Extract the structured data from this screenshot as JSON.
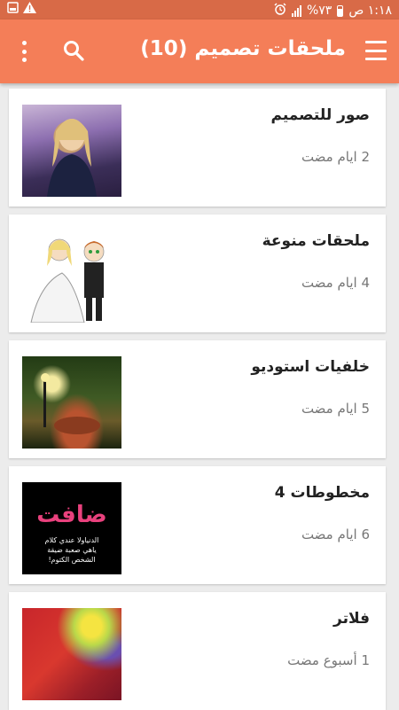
{
  "status_bar": {
    "time": "١:١٨ ص",
    "battery": "%٧٣",
    "icons": [
      "alarm-icon",
      "signal-icon",
      "battery-icon",
      "warning-icon",
      "image-notification-icon"
    ]
  },
  "app_bar": {
    "title": "ملحقات تصميم (10)",
    "icons": [
      "menu-icon",
      "search-icon",
      "more-vert-icon"
    ],
    "color": "#f47e58"
  },
  "items": [
    {
      "title": "صور للتصميم",
      "time": "2 ايام مضت",
      "thumb": "portrait-photo"
    },
    {
      "title": "ملحقات منوعة",
      "time": "4 ايام مضت",
      "thumb": "cartoon-couple"
    },
    {
      "title": "خلفيات استوديو",
      "time": "5 ايام مضت",
      "thumb": "studio-background"
    },
    {
      "title": "مخطوطات 4",
      "time": "6 ايام مضت",
      "thumb": "calligraphy-image",
      "thumb_text": {
        "heading": "ضافت",
        "line1": "الدنياولا عندي كلام",
        "line2": "ياهي صعبة ضيقة",
        "line3": "الشخص الكتوم!"
      }
    },
    {
      "title": "فلاتر",
      "time": "1 أسبوع مضت",
      "thumb": "color-filter"
    }
  ]
}
